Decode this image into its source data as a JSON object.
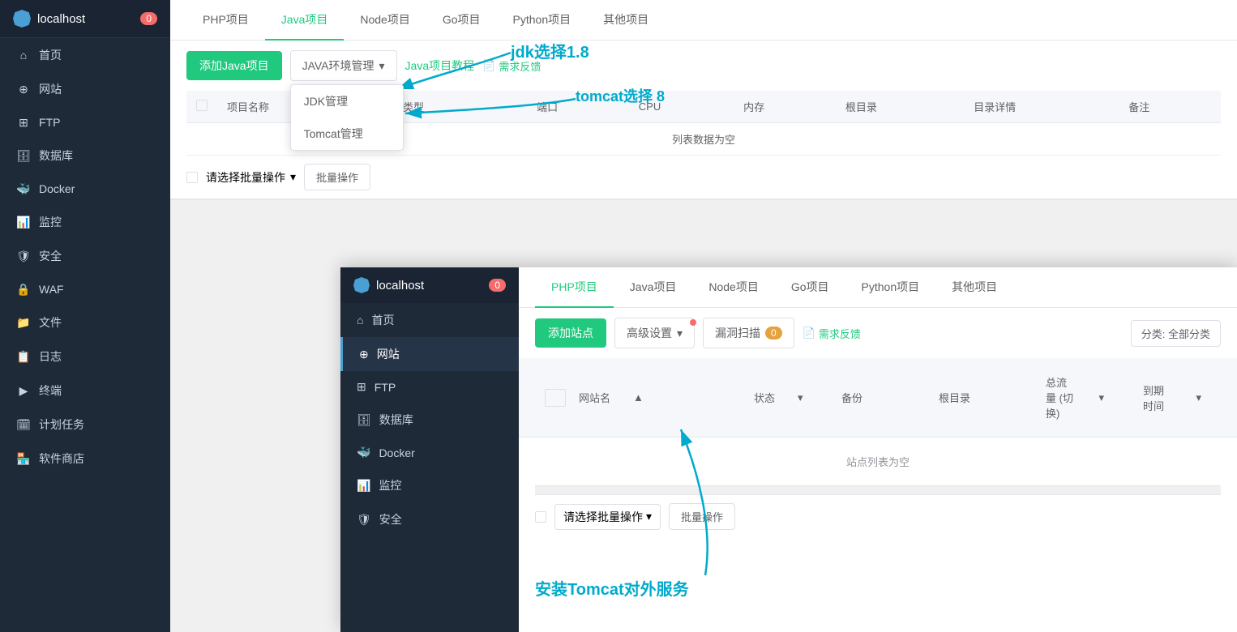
{
  "sidebar": {
    "logo": "localhost",
    "badge": "0",
    "items": [
      {
        "label": "首页",
        "icon": "home"
      },
      {
        "label": "网站",
        "icon": "globe"
      },
      {
        "label": "FTP",
        "icon": "ftp"
      },
      {
        "label": "数据库",
        "icon": "database"
      },
      {
        "label": "Docker",
        "icon": "docker"
      },
      {
        "label": "监控",
        "icon": "monitor"
      },
      {
        "label": "安全",
        "icon": "shield"
      },
      {
        "label": "WAF",
        "icon": "waf"
      },
      {
        "label": "文件",
        "icon": "file"
      },
      {
        "label": "日志",
        "icon": "log"
      },
      {
        "label": "终端",
        "icon": "terminal"
      },
      {
        "label": "计划任务",
        "icon": "task"
      },
      {
        "label": "软件商店",
        "icon": "store"
      }
    ]
  },
  "tabs": [
    {
      "label": "PHP项目",
      "active": false
    },
    {
      "label": "Java项目",
      "active": true
    },
    {
      "label": "Node项目",
      "active": false
    },
    {
      "label": "Go项目",
      "active": false
    },
    {
      "label": "Python项目",
      "active": false
    },
    {
      "label": "其他项目",
      "active": false
    }
  ],
  "toolbar": {
    "add_java_label": "添加Java项目",
    "java_env_label": "JAVA环境管理",
    "java_tutorial_label": "Java项目教程",
    "feedback_label": "需求反馈"
  },
  "dropdown": {
    "items": [
      {
        "label": "JDK管理"
      },
      {
        "label": "Tomcat管理"
      }
    ]
  },
  "table": {
    "columns": [
      "项目名称",
      "项目类型",
      "端口",
      "CPU",
      "内存",
      "根目录",
      "目录详情",
      "备注"
    ],
    "empty_text": "列表数据为空"
  },
  "bottom_toolbar": {
    "select_placeholder": "请选择批量操作",
    "batch_label": "批量操作"
  },
  "annotations": {
    "jdk_label": "jdk选择1.8",
    "tomcat_label": "tomcat选择  8",
    "install_label": "安装Tomcat对外服务"
  },
  "second_window": {
    "logo": "localhost",
    "badge": "0",
    "sidebar_items": [
      {
        "label": "首页",
        "icon": "home"
      },
      {
        "label": "网站",
        "icon": "globe",
        "active": true
      },
      {
        "label": "FTP",
        "icon": "ftp"
      },
      {
        "label": "数据库",
        "icon": "database"
      },
      {
        "label": "Docker",
        "icon": "docker"
      },
      {
        "label": "监控",
        "icon": "monitor"
      },
      {
        "label": "安全",
        "icon": "shield"
      }
    ],
    "tabs": [
      {
        "label": "PHP项目",
        "active": true
      },
      {
        "label": "Java项目",
        "active": false
      },
      {
        "label": "Node项目",
        "active": false
      },
      {
        "label": "Go项目",
        "active": false
      },
      {
        "label": "Python项目",
        "active": false
      },
      {
        "label": "其他项目",
        "active": false
      }
    ],
    "toolbar": {
      "add_site_label": "添加站点",
      "advanced_label": "高级设置",
      "vuln_scan_label": "漏洞扫描",
      "vuln_badge": "0",
      "feedback_label": "需求反馈",
      "classify_label": "分类: 全部分类"
    },
    "table_headers": [
      "网站名",
      "状态",
      "备份",
      "根目录",
      "总流量 (切换)",
      "到期时间"
    ],
    "empty_text": "站点列表为空",
    "bottom_toolbar": {
      "select_placeholder": "请选择批量操作",
      "batch_label": "批量操作"
    }
  }
}
